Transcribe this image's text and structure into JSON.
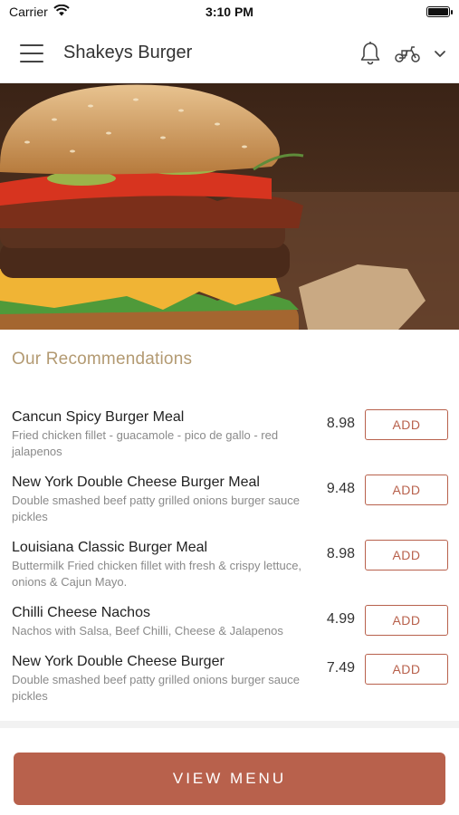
{
  "status_bar": {
    "carrier": "Carrier",
    "time": "3:10 PM"
  },
  "header": {
    "title": "Shakeys Burger",
    "icons": [
      "menu-icon",
      "bell-icon",
      "scooter-icon",
      "chevron-down-icon"
    ]
  },
  "hero": {
    "icon": "burger-photo"
  },
  "recommendations": {
    "title": "Our Recommendations",
    "add_label": "ADD",
    "items": [
      {
        "name": "Cancun Spicy Burger Meal",
        "desc": "Fried chicken fillet - guacamole - pico de gallo - red jalapenos",
        "price": "8.98"
      },
      {
        "name": "New York Double Cheese Burger Meal",
        "desc": "Double smashed beef patty grilled onions burger sauce pickles",
        "price": "9.48"
      },
      {
        "name": "Louisiana Classic Burger Meal",
        "desc": "Buttermilk Fried chicken fillet with fresh & crispy lettuce, onions & Cajun Mayo.",
        "price": "8.98"
      },
      {
        "name": "Chilli Cheese Nachos",
        "desc": "Nachos with Salsa, Beef Chilli, Cheese & Jalapenos",
        "price": "4.99"
      },
      {
        "name": "New York Double Cheese Burger",
        "desc": "Double smashed beef patty grilled onions burger sauce pickles",
        "price": "7.49"
      }
    ]
  },
  "footer": {
    "view_menu_label": "VIEW MENU"
  },
  "colors": {
    "accent": "#b8614c",
    "section_title": "#b39a72"
  }
}
